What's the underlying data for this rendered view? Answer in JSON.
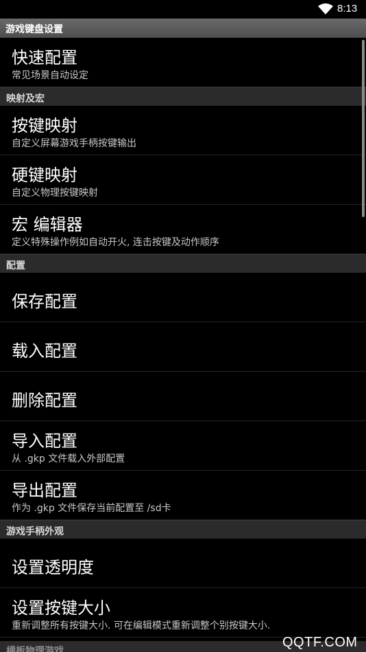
{
  "status": {
    "time": "8:13",
    "icon": "wifi-icon"
  },
  "title": "游戏键盘设置",
  "sections": [
    {
      "type": "item",
      "title": "快速配置",
      "subtitle": "常见场景自动设定"
    },
    {
      "type": "header",
      "title": "映射及宏"
    },
    {
      "type": "item",
      "title": "按键映射",
      "subtitle": "自定义屏幕游戏手柄按键输出"
    },
    {
      "type": "item",
      "title": "硬键映射",
      "subtitle": "自定义物理按键映射"
    },
    {
      "type": "item",
      "title": "宏 编辑器",
      "subtitle": "定义特殊操作例如自动开火, 连击按键及动作顺序"
    },
    {
      "type": "header",
      "title": "配置"
    },
    {
      "type": "item",
      "title": "保存配置",
      "subtitle": ""
    },
    {
      "type": "item",
      "title": "载入配置",
      "subtitle": ""
    },
    {
      "type": "item",
      "title": "删除配置",
      "subtitle": ""
    },
    {
      "type": "item",
      "title": "导入配置",
      "subtitle": "从 .gkp 文件载入外部配置"
    },
    {
      "type": "item",
      "title": "导出配置",
      "subtitle": "作为 .gkp 文件保存当前配置至 /sd卡"
    },
    {
      "type": "header",
      "title": "游戏手柄外观"
    },
    {
      "type": "item",
      "title": "设置透明度",
      "subtitle": ""
    },
    {
      "type": "item",
      "title": "设置按键大小",
      "subtitle": "重新调整所有按键大小. 可在编辑模式重新调整个别按键大小."
    }
  ],
  "partial_header": "横板物理游戏",
  "watermark": "QQTF.COM"
}
